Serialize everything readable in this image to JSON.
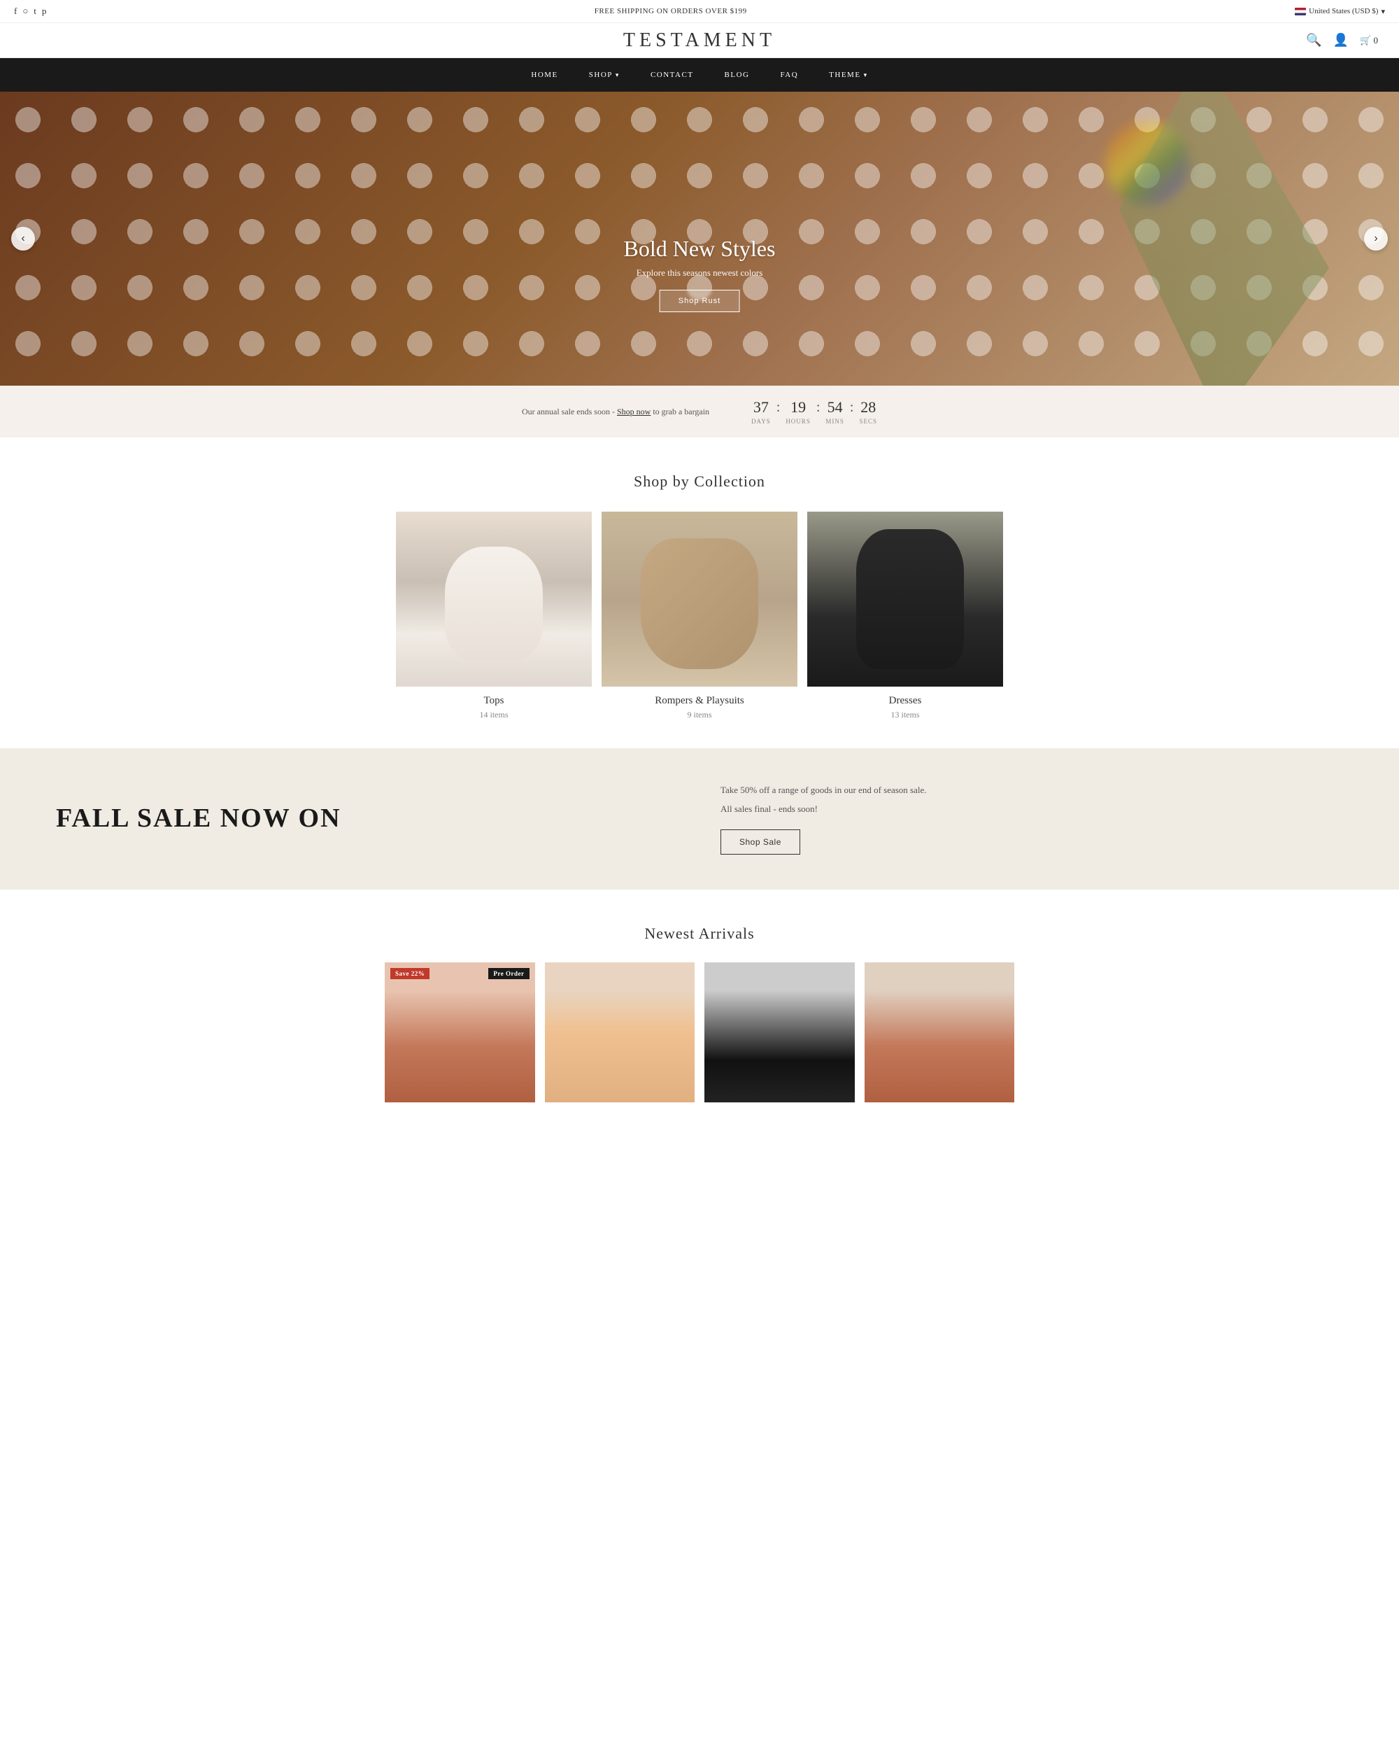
{
  "topbar": {
    "shipping_text": "FREE SHIPPING ON ORDERS OVER $199",
    "region": "United States (USD $)",
    "social": [
      "facebook",
      "instagram",
      "twitter",
      "pinterest"
    ]
  },
  "header": {
    "logo": "TESTAMENT",
    "cart_count": "0"
  },
  "nav": {
    "items": [
      {
        "label": "HOME",
        "has_dropdown": false
      },
      {
        "label": "SHOP",
        "has_dropdown": true
      },
      {
        "label": "CONTACT",
        "has_dropdown": false
      },
      {
        "label": "BLOG",
        "has_dropdown": false
      },
      {
        "label": "FAQ",
        "has_dropdown": false
      },
      {
        "label": "THEME",
        "has_dropdown": true
      }
    ]
  },
  "hero": {
    "title": "Bold New Styles",
    "subtitle": "Explore this seasons newest colors",
    "button_label": "Shop Rust",
    "prev_label": "‹",
    "next_label": "›"
  },
  "countdown": {
    "text_before": "Our annual sale ends soon -",
    "link_text": "Shop now",
    "text_after": "to grab a bargain",
    "days": "37",
    "hours": "19",
    "mins": "54",
    "secs": "28",
    "days_label": "Days",
    "hours_label": "Hours",
    "mins_label": "Mins",
    "secs_label": "Secs"
  },
  "collections": {
    "section_title": "Shop by Collection",
    "items": [
      {
        "name": "Tops",
        "count": "14 items"
      },
      {
        "name": "Rompers & Playsuits",
        "count": "9 items"
      },
      {
        "name": "Dresses",
        "count": "13 items"
      }
    ]
  },
  "sale_banner": {
    "title": "FALL SALE NOW ON",
    "description_line1": "Take 50% off a range of goods in our end of season sale.",
    "description_line2": "All sales final - ends soon!",
    "button_label": "Shop Sale"
  },
  "arrivals": {
    "section_title": "Newest Arrivals",
    "items": [
      {
        "badge_left": "Save 22%",
        "badge_right": "Pre Order"
      },
      {
        "badge_left": "",
        "badge_right": ""
      },
      {
        "badge_left": "",
        "badge_right": ""
      },
      {
        "badge_left": "",
        "badge_right": ""
      }
    ]
  }
}
